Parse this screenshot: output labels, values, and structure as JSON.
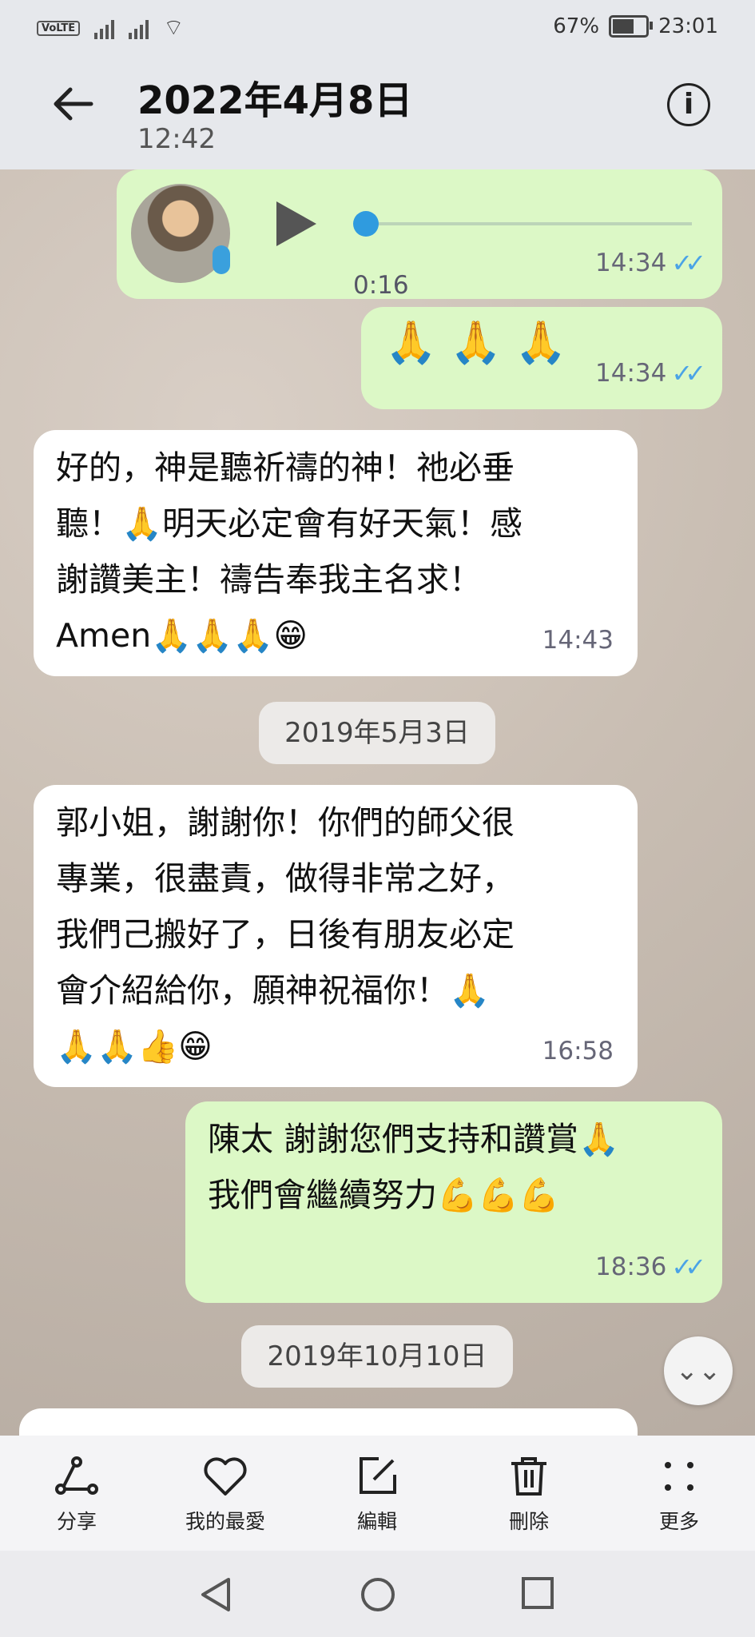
{
  "status": {
    "battery": "67%",
    "time": "23:01",
    "volte": "VoLTE"
  },
  "header": {
    "title": "2022年4月8日",
    "subtitle": "12:42",
    "info_icon": "info-icon"
  },
  "messages": {
    "voice": {
      "duration": "0:16",
      "time": "14:34"
    },
    "prayers": {
      "emoji": "🙏 🙏 🙏",
      "time": "14:34"
    },
    "m3": {
      "line1": "好的，神是聽祈禱的神！祂必垂",
      "line2": "聽！🙏明天必定會有好天氣！感",
      "line3": "謝讚美主！禱告奉我主名求！",
      "line4": "Amen🙏🙏🙏😁",
      "time": "14:43"
    },
    "date1": "2019年5月3日",
    "m4": {
      "line1": "郭小姐，謝謝你！你們的師父很",
      "line2": "專業，很盡責，做得非常之好，",
      "line3": "我們己搬好了，日後有朋友必定",
      "line4": "會介紹給你，願神祝福你！🙏",
      "line5": "🙏🙏👍😁",
      "time": "16:58"
    },
    "m5": {
      "line1": "陳太 謝謝您們支持和讚賞🙏",
      "line2": "我們會繼續努力💪💪💪",
      "time": "18:36"
    },
    "date2": "2019年10月10日"
  },
  "actions": [
    {
      "label": "分享",
      "icon": "share-icon"
    },
    {
      "label": "我的最愛",
      "icon": "heart-icon"
    },
    {
      "label": "編輯",
      "icon": "edit-icon"
    },
    {
      "label": "刪除",
      "icon": "trash-icon"
    },
    {
      "label": "更多",
      "icon": "more-icon"
    }
  ],
  "colors": {
    "outgoing": "#dcf8c6",
    "incoming": "#ffffff",
    "tick": "#4aa3e6"
  }
}
